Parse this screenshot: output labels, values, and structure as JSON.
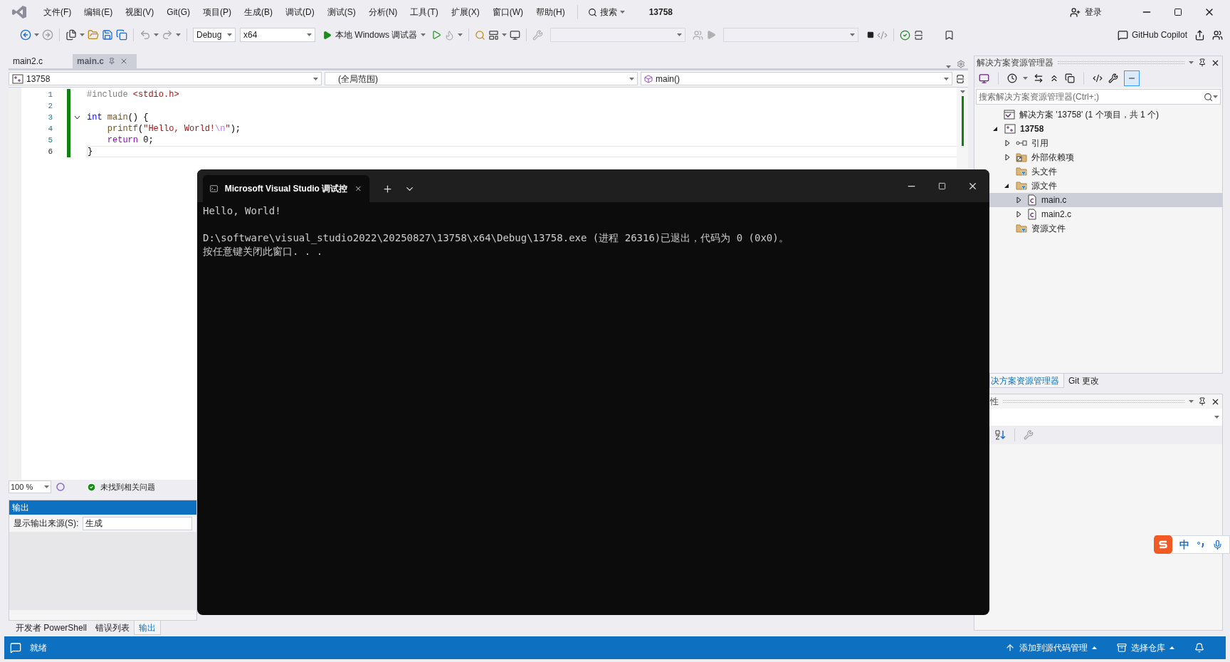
{
  "menu": [
    "文件(F)",
    "编辑(E)",
    "视图(V)",
    "Git(G)",
    "项目(P)",
    "生成(B)",
    "调试(D)",
    "测试(S)",
    "分析(N)",
    "工具(T)",
    "扩展(X)",
    "窗口(W)",
    "帮助(H)"
  ],
  "search": "搜索",
  "solution_name": "13758",
  "signin": "登录",
  "toolbar": {
    "config": "Debug",
    "platform": "x64",
    "run": "本地 Windows 调试器",
    "copilot": "GitHub Copilot"
  },
  "doc_tabs": [
    {
      "label": "main2.c",
      "selected": false
    },
    {
      "label": "main.c",
      "selected": true
    }
  ],
  "nav": {
    "project": "13758",
    "scope": "(全局范围)",
    "member": "main()"
  },
  "code": [
    {
      "number": "1",
      "current": false,
      "tokens": [
        {
          "kind": "preproc",
          "text": "#include "
        },
        {
          "kind": "string",
          "text": "<stdio.h>"
        }
      ]
    },
    {
      "number": "2",
      "current": false
    },
    {
      "number": "3",
      "current": false,
      "fold": {
        "expanded": true
      },
      "tokens": [
        {
          "kind": "keyword",
          "text": "int "
        },
        {
          "kind": "func",
          "text": "main"
        },
        {
          "kind": "plain",
          "text": "() {"
        }
      ]
    },
    {
      "number": "4",
      "current": false,
      "tokens": [
        {
          "kind": "func",
          "text": "    printf"
        },
        {
          "kind": "plain",
          "text": "("
        },
        {
          "kind": "string",
          "text": "\"Hello, World!"
        },
        {
          "kind": "escape",
          "text": "\\n"
        },
        {
          "kind": "string",
          "text": "\""
        },
        {
          "kind": "plain",
          "text": ");"
        }
      ]
    },
    {
      "number": "5",
      "current": false,
      "tokens": [
        {
          "kind": "control",
          "text": "    return"
        },
        {
          "kind": "plain",
          "text": " 0;"
        }
      ]
    },
    {
      "number": "6",
      "current": true,
      "tokens": [
        {
          "kind": "plain",
          "text": "}"
        }
      ]
    }
  ],
  "zoom": "100 %",
  "issues": "未找到相关问题",
  "output": {
    "title": "输出",
    "source_label": "显示输出来源(S):",
    "source_value": "生成"
  },
  "bottom_tabs": [
    {
      "label": "开发者 PowerShell",
      "selected": false
    },
    {
      "label": "错误列表",
      "selected": false
    },
    {
      "label": "输出",
      "selected": true
    }
  ],
  "solution_explorer": {
    "title": "解决方案资源管理器",
    "search_placeholder": "搜索解决方案资源管理器(Ctrl+;)",
    "tree": [
      {
        "label": "解决方案 '13758' (1 个项目，共 1 个)",
        "kind": "solution",
        "selected": false,
        "children": [
          {
            "label": "13758",
            "kind": "project",
            "selected": false,
            "expanded": true,
            "children": [
              {
                "label": "引用",
                "kind": "references",
                "selected": false,
                "expanded": false
              },
              {
                "label": "外部依赖项",
                "kind": "external",
                "selected": false,
                "expanded": false
              },
              {
                "label": "头文件",
                "kind": "filter",
                "selected": false
              },
              {
                "label": "源文件",
                "kind": "filter",
                "selected": false,
                "expanded": true,
                "children": [
                  {
                    "label": "main.c",
                    "kind": "file",
                    "selected": true,
                    "expanded": false
                  },
                  {
                    "label": "main2.c",
                    "kind": "file",
                    "selected": false,
                    "expanded": false
                  }
                ]
              },
              {
                "label": "资源文件",
                "kind": "filter",
                "selected": false
              }
            ]
          }
        ]
      }
    ]
  },
  "side_tabs": [
    {
      "label": "决方案资源管理器",
      "selected": true
    },
    {
      "label": "Git 更改",
      "selected": false
    }
  ],
  "properties": {
    "title": "性"
  },
  "status": {
    "text": "就绪",
    "add_source": "添加到源代码管理",
    "repo": "选择仓库"
  },
  "terminal": {
    "tab_title": "Microsoft Visual Studio 调试控",
    "blocks": [
      [
        "Hello, World!"
      ],
      [
        "D:\\software\\visual_studio2022\\20250827\\13758\\x64\\Debug\\13758.exe (进程 26316)已退出，代码为 0 (0x0)。",
        "按任意键关闭此窗口. . ."
      ]
    ]
  },
  "ime": {
    "mode": "中"
  }
}
